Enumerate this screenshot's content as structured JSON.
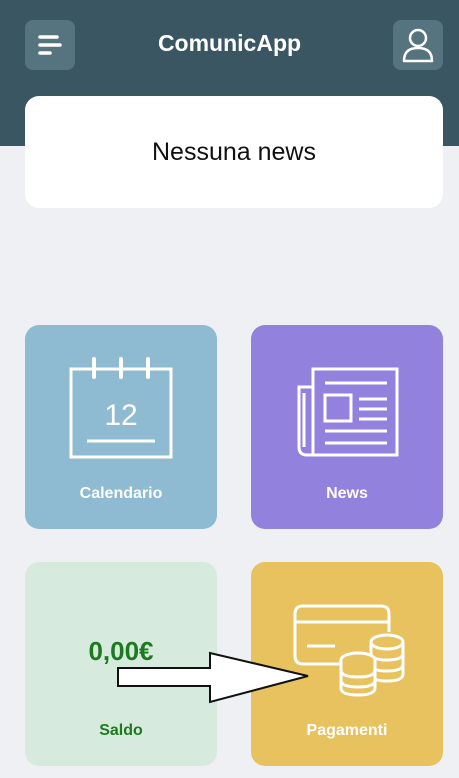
{
  "header": {
    "title": "ComunicApp",
    "menu_icon": "menu-icon",
    "profile_icon": "user-icon"
  },
  "news_card": {
    "text": "Nessuna news"
  },
  "tiles": {
    "calendar": {
      "label": "Calendario",
      "date_number": "12",
      "icon": "calendar-icon",
      "color": "#8ebbd2"
    },
    "news": {
      "label": "News",
      "icon": "newspaper-icon",
      "color": "#9282dd"
    },
    "saldo": {
      "label": "Saldo",
      "value": "0,00€",
      "color": "#d6ebdd"
    },
    "payments": {
      "label": "Pagamenti",
      "icon": "card-coins-icon",
      "color": "#e8c25e"
    }
  },
  "colors": {
    "header": "#3a5663",
    "background": "#eef0f4",
    "saldo_text": "#1e7a1e"
  }
}
